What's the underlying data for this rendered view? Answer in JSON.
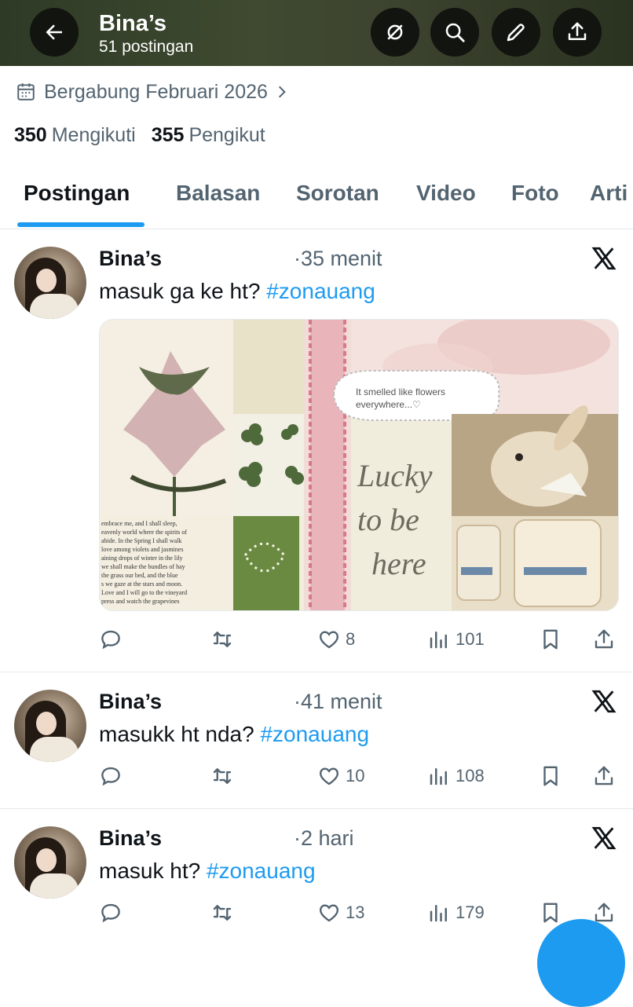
{
  "header": {
    "title": "Bina’s",
    "subtitle": "51 postingan"
  },
  "profile": {
    "joined": "Bergabung Februari 2026",
    "following_count": "350",
    "following_label": "Mengikuti",
    "followers_count": "355",
    "followers_label": "Pengikut"
  },
  "tabs": [
    "Postingan",
    "Balasan",
    "Sorotan",
    "Video",
    "Foto",
    "Arti"
  ],
  "posts": [
    {
      "name": "Bina’s",
      "time": "·35 menit",
      "text": "masuk ga ke ht? ",
      "hashtag": "#zonauang",
      "likes": "8",
      "views": "101"
    },
    {
      "name": "Bina’s",
      "time": "·41 menit",
      "text": "masukk ht nda? ",
      "hashtag": "#zonauang",
      "likes": "10",
      "views": "108"
    },
    {
      "name": "Bina’s",
      "time": "·2 hari",
      "text": "masuk ht? ",
      "hashtag": "#zonauang",
      "likes": "13",
      "views": "179"
    }
  ],
  "media": {
    "speech": "It smelled like flowers everywhere...♡",
    "script_line1": "Lucky",
    "script_line2": "to be",
    "script_line3": "here",
    "book_text": "embrace me, and I shall sleep, eavenly world where the spirits of abide. In the Spring I shall walk love among violets and jasmines aining drops of winter in the lily we shall make the bundles of hay the grass our bed, and the blue s we gaze at the stars and moon. Love and I will go to the vineyard press and watch the grapevines"
  },
  "colors": {
    "accent": "#1d9bf0",
    "text": "#0f1419",
    "muted": "#536471",
    "header_bg": "#3b452e"
  }
}
